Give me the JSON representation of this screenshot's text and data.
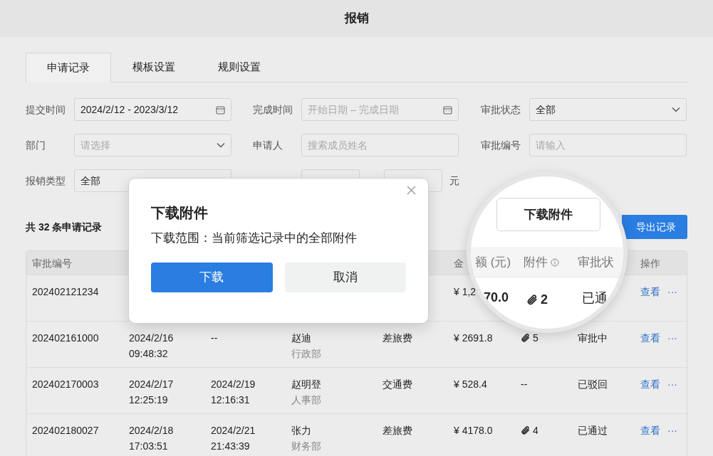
{
  "window": {
    "title": "报销"
  },
  "tabs": [
    {
      "label": "申请记录",
      "selected": true
    },
    {
      "label": "模板设置",
      "selected": false
    },
    {
      "label": "规则设置",
      "selected": false
    }
  ],
  "filters": [
    {
      "label": "提交时间",
      "value": "2024/2/12 - 2023/3/12",
      "kind": "date"
    },
    {
      "label": "完成时间",
      "placeholder": "开始日期 – 完成日期",
      "kind": "date"
    },
    {
      "label": "审批状态",
      "value": "全部",
      "kind": "select"
    },
    {
      "label": "部门",
      "placeholder": "请选择",
      "kind": "select"
    },
    {
      "label": "申请人",
      "placeholder": "搜索成员姓名",
      "kind": "text"
    },
    {
      "label": "审批编号",
      "placeholder": "请输入",
      "kind": "text"
    },
    {
      "label": "报销类型",
      "value": "全部",
      "kind": "text"
    }
  ],
  "amount_unit": "元",
  "record_count": "共 32 条申请记录",
  "export_button": "导出记录",
  "table": {
    "columns": [
      "审批编号",
      null,
      null,
      null,
      null,
      "金",
      null,
      null,
      "操作"
    ],
    "rows": [
      {
        "id": "202402121234",
        "amount": "¥ 1,2",
        "action": "查看",
        "more": "···"
      },
      {
        "id": "202402161000",
        "submitted": [
          "2024/2/16",
          "09:48:32"
        ],
        "completed": [
          "--"
        ],
        "applicant": "赵迪",
        "dept": "行政部",
        "type": "差旅费",
        "amount": "¥ 2691.8",
        "has_file": true,
        "attachments": "5",
        "status": "审批中",
        "action": "查看",
        "more": "···"
      },
      {
        "id": "202402170003",
        "submitted": [
          "2024/2/17",
          "12:25:19"
        ],
        "completed": [
          "2024/2/19",
          "12:16:31"
        ],
        "applicant": "赵明登",
        "dept": "人事部",
        "type": "交通费",
        "amount": "¥ 528.4",
        "has_file": false,
        "attachments": "--",
        "status": "已驳回",
        "action": "查看",
        "more": "···"
      },
      {
        "id": "202402180027",
        "submitted": [
          "2024/2/18",
          "17:03:51"
        ],
        "completed": [
          "2024/2/21",
          "21:43:39"
        ],
        "applicant": "张力",
        "dept": "财务部",
        "type": "差旅费",
        "amount": "¥ 4178.0",
        "has_file": true,
        "attachments": "4",
        "status": "已通过",
        "action": "查看",
        "more": "···"
      }
    ]
  },
  "magnifier": {
    "button": "下载附件",
    "columns": [
      "额 (元)",
      "附件",
      "审批状"
    ],
    "amount": "70.0",
    "has_file": true,
    "attachments": "2",
    "status": "已通"
  },
  "dialog": {
    "title": "下载附件",
    "message": "下载范围：当前筛选记录中的全部附件",
    "confirm": "下载",
    "cancel": "取消"
  }
}
